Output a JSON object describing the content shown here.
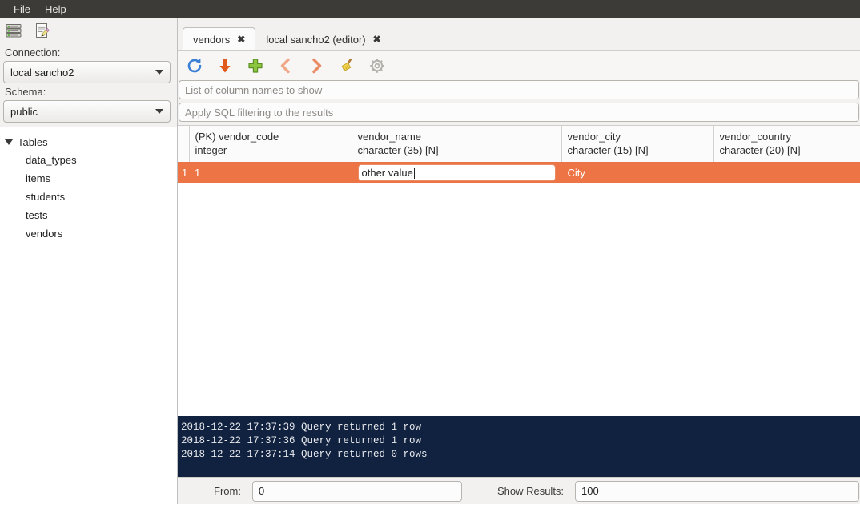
{
  "menubar": {
    "items": [
      {
        "label": "File"
      },
      {
        "label": "Help"
      }
    ]
  },
  "sidebar": {
    "toolbar": [
      {
        "name": "database-server-icon",
        "tooltip": "Connections"
      },
      {
        "name": "editor-document-icon",
        "tooltip": "SQL Editor"
      }
    ],
    "connection_label": "Connection:",
    "connection_value": "local sancho2",
    "schema_label": "Schema:",
    "schema_value": "public",
    "tree_root": "Tables",
    "tables": [
      {
        "label": "data_types"
      },
      {
        "label": "items"
      },
      {
        "label": "students"
      },
      {
        "label": "tests"
      },
      {
        "label": "vendors"
      }
    ]
  },
  "tabs": [
    {
      "label": "vendors",
      "active": true,
      "close": "✖"
    },
    {
      "label": "local sancho2 (editor)",
      "active": false,
      "close": "✖"
    }
  ],
  "toolbar": {
    "buttons": [
      {
        "name": "refresh-icon",
        "label": "Refresh"
      },
      {
        "name": "download-arrow-icon",
        "label": "Export"
      },
      {
        "name": "add-row-icon",
        "label": "Add row"
      },
      {
        "name": "previous-page-icon",
        "label": "Previous"
      },
      {
        "name": "next-page-icon",
        "label": "Next"
      },
      {
        "name": "clear-broom-icon",
        "label": "Clear"
      },
      {
        "name": "settings-gear-icon",
        "label": "Settings"
      }
    ]
  },
  "filters": {
    "columns_placeholder": "List of column names to show",
    "columns_value": "",
    "sql_placeholder": "Apply SQL filtering to the results",
    "sql_value": ""
  },
  "grid": {
    "columns": [
      {
        "name": "(PK) vendor_code",
        "type": "integer"
      },
      {
        "name": "vendor_name",
        "type": "character (35) [N]"
      },
      {
        "name": "vendor_city",
        "type": "character (15) [N]"
      },
      {
        "name": "vendor_country",
        "type": "character (20) [N]"
      }
    ],
    "rows": [
      {
        "row_number": "1",
        "selected": true,
        "cells": [
          {
            "value": "1",
            "editing": false
          },
          {
            "value": "other value",
            "editing": true
          },
          {
            "value": "City",
            "editing": false
          },
          {
            "value": "",
            "editing": false
          }
        ]
      }
    ]
  },
  "log": {
    "lines": [
      "2018-12-22 17:37:39 Query returned 1 row",
      "2018-12-22 17:37:36 Query returned 1 row",
      "2018-12-22 17:37:14 Query returned 0 rows"
    ]
  },
  "statusbar": {
    "from_label": "From:",
    "from_value": "0",
    "show_label": "Show Results:",
    "show_value": "100"
  },
  "colors": {
    "menubar_bg": "#3c3b37",
    "selection_orange": "#ed7445",
    "log_bg": "#112240",
    "panel_bg": "#f2f1f0"
  }
}
